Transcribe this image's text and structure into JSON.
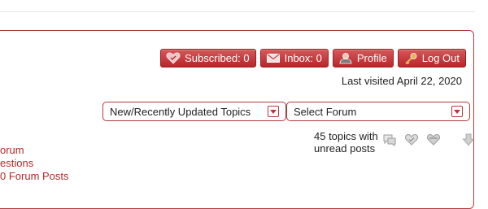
{
  "toolbar": {
    "subscribed_label": "Subscribed: 0",
    "inbox_label": "Inbox: 0",
    "profile_label": "Profile",
    "logout_label": "Log Out"
  },
  "last_visited": "Last visited April 22, 2020",
  "dropdowns": {
    "topics_selected": "New/Recently Updated Topics",
    "forum_selected": "Select Forum"
  },
  "unread": {
    "line1": "45 topics with",
    "line2": "unread posts"
  },
  "left_links": [
    "orum",
    "estions",
    "0 Forum Posts"
  ],
  "icons": {
    "subscribed": "heart-icon",
    "inbox": "envelope-icon",
    "profile": "user-icon",
    "logout": "key-icon"
  },
  "colors": {
    "accent": "#b9252a",
    "border": "#b33a3a",
    "link": "#b22a2a"
  }
}
